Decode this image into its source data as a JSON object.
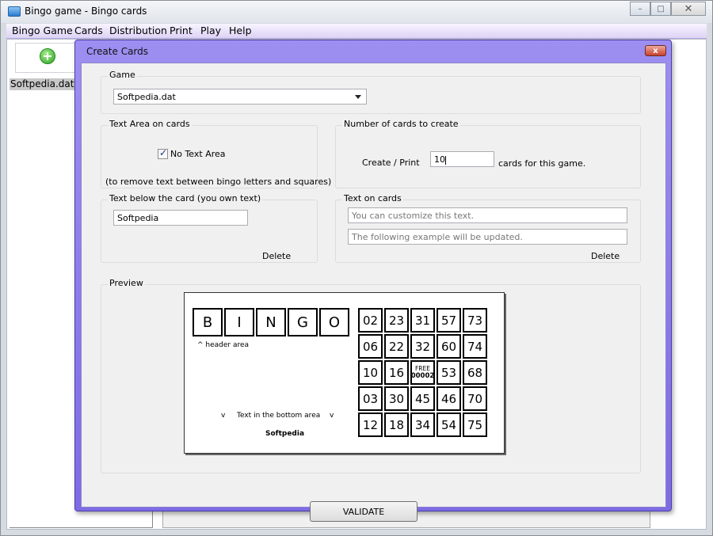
{
  "main_window": {
    "title": "Bingo game - Bingo cards",
    "menu": [
      "Bingo Game",
      "Cards",
      "Distribution",
      "Print",
      "Play",
      "Help"
    ],
    "file_list": [
      "Softpedia.dat"
    ],
    "minimize_glyph": "–",
    "maximize_glyph": "□",
    "close_glyph": "✕"
  },
  "dialog": {
    "title": "Create Cards",
    "close_glyph": "x",
    "game": {
      "legend": "Game",
      "selected": "Softpedia.dat"
    },
    "text_area": {
      "legend": "Text Area on cards",
      "checkbox_label": "No Text Area",
      "checked": true,
      "note": "(to remove text between bingo letters and squares)"
    },
    "num_cards": {
      "legend": "Number of cards to create",
      "prefix": "Create / Print",
      "value": "10",
      "suffix": "cards for this game."
    },
    "text_below": {
      "legend": "Text below the card (you own text)",
      "value": "Softpedia",
      "delete_label": "Delete"
    },
    "text_on_cards": {
      "legend": "Text on cards",
      "placeholder1": "You can customize this text.",
      "placeholder2": "The following example will be updated.",
      "delete_label": "Delete"
    },
    "preview": {
      "legend": "Preview",
      "letters": [
        "B",
        "I",
        "N",
        "G",
        "O"
      ],
      "header_note": "^  header area",
      "bottom_left_mark": "v",
      "bottom_note": "Text in the bottom area",
      "bottom_right_mark": "v",
      "footer_text": "Softpedia",
      "grid": [
        [
          "02",
          "23",
          "31",
          "57",
          "73"
        ],
        [
          "06",
          "22",
          "32",
          "60",
          "74"
        ],
        [
          "10",
          "16",
          "FREE",
          "53",
          "68"
        ],
        [
          "03",
          "30",
          "45",
          "46",
          "70"
        ],
        [
          "12",
          "18",
          "34",
          "54",
          "75"
        ]
      ],
      "free_label": "FREE",
      "free_number": "00002"
    },
    "validate_label": "VALIDATE"
  }
}
